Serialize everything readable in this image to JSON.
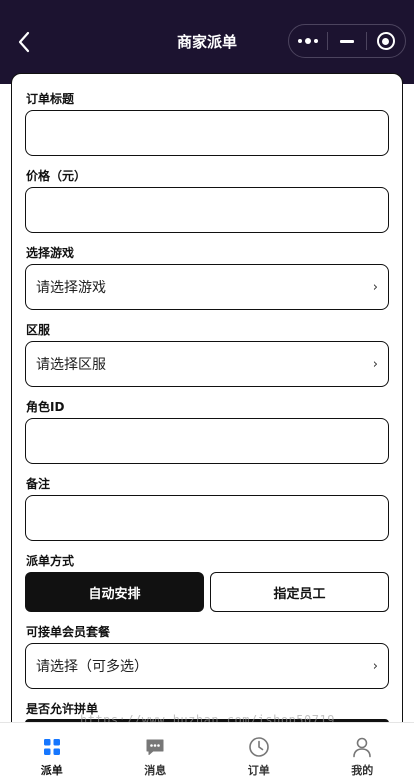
{
  "navbar": {
    "title": "商家派单"
  },
  "form": {
    "order_title": {
      "label": "订单标题",
      "value": ""
    },
    "price": {
      "label": "价格（元）",
      "value": ""
    },
    "game": {
      "label": "选择游戏",
      "placeholder": "请选择游戏"
    },
    "server": {
      "label": "区服",
      "placeholder": "请选择区服"
    },
    "role_id": {
      "label": "角色ID",
      "value": ""
    },
    "remark": {
      "label": "备注",
      "value": ""
    },
    "dispatch_mode": {
      "label": "派单方式",
      "options": [
        "自动安排",
        "指定员工"
      ],
      "selected": "自动安排"
    },
    "member_plan": {
      "label": "可接单会员套餐",
      "placeholder": "请选择（可多选）"
    },
    "allow_merge": {
      "label": "是否允许拼单"
    },
    "chevron": "›"
  },
  "watermark": "https://www.huzhan.com/ishop50719",
  "tabbar": {
    "items": [
      {
        "label": "派单",
        "icon": "grid-icon",
        "active": true
      },
      {
        "label": "消息",
        "icon": "chat-icon",
        "active": false
      },
      {
        "label": "订单",
        "icon": "clock-icon",
        "active": false
      },
      {
        "label": "我的",
        "icon": "person-icon",
        "active": false
      }
    ]
  },
  "colors": {
    "navbar_bg": "#1c1330",
    "accent": "#1677ff",
    "ink": "#111111"
  }
}
